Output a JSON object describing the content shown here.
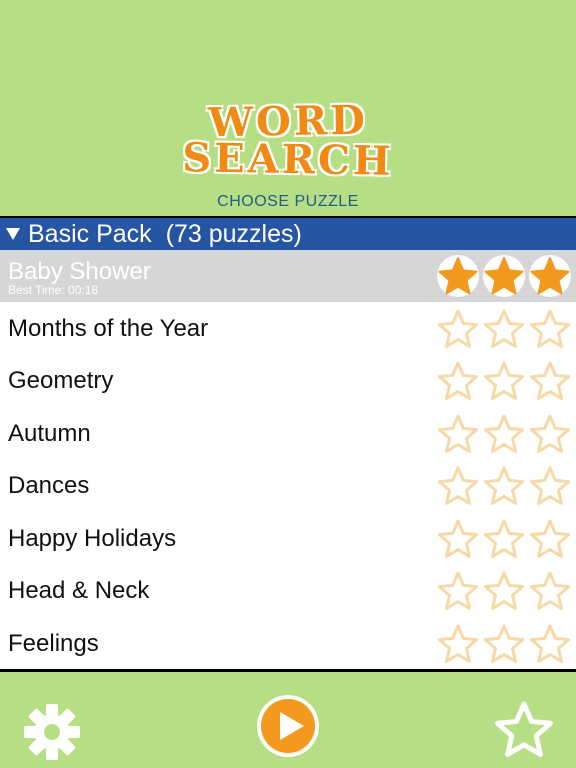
{
  "app": {
    "logo_line1": "WORD",
    "logo_line2": "SEARCH",
    "subtitle": "CHOOSE PUZZLE"
  },
  "pack": {
    "name": "Basic Pack",
    "count": "(73 puzzles)"
  },
  "puzzles": [
    {
      "title": "Baby Shower",
      "best_time": "Best Time: 00:18",
      "stars": 3,
      "selected": true
    },
    {
      "title": "Months of the Year",
      "stars": 0
    },
    {
      "title": "Geometry",
      "stars": 0
    },
    {
      "title": "Autumn",
      "stars": 0
    },
    {
      "title": "Dances",
      "stars": 0
    },
    {
      "title": "Happy Holidays",
      "stars": 0
    },
    {
      "title": "Head & Neck",
      "stars": 0
    },
    {
      "title": "Feelings",
      "stars": 0
    }
  ],
  "colors": {
    "background": "#b6de85",
    "pack_header": "#2656a3",
    "star_filled": "#f39a1e",
    "star_outline": "#f7d9a8",
    "play_button": "#f39a1e"
  },
  "footer": {
    "settings_icon": "gear-icon",
    "play_icon": "play-icon",
    "favorites_icon": "star-icon"
  }
}
